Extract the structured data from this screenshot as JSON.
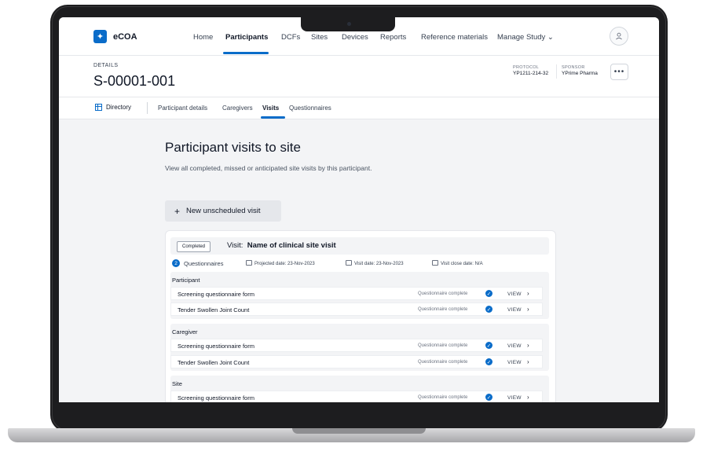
{
  "app": {
    "logo_text": "eCOA"
  },
  "nav": {
    "items": [
      "Home",
      "Participants",
      "DCFs",
      "Sites",
      "Devices",
      "Reports",
      "Reference materials",
      "Manage Study ⌄"
    ],
    "active": "Participants"
  },
  "details": {
    "kicker": "DETAILS",
    "id": "S-00001-001",
    "protocol_label": "PROTOCOL",
    "protocol_value": "YP1211-214-32",
    "sponsor_label": "SPONSOR",
    "sponsor_value": "YPrime Pharma",
    "more_label": "•••"
  },
  "subnav": {
    "directory_label": "Directory",
    "tabs": [
      "Participant details",
      "Caregivers",
      "Visits",
      "Questionnaires"
    ],
    "active": "Visits"
  },
  "page": {
    "title": "Participant visits to site",
    "description": "View all completed, missed or anticipated site visits by this participant.",
    "new_visit_label": "New unscheduled visit"
  },
  "visit": {
    "status": "Completed",
    "name_prefix": "Visit:",
    "name": "Name of clinical site visit",
    "questionnaire_count": "2",
    "questionnaires_label": "Questionnaires",
    "projected_date": "Projected date: 23-Nov-2023",
    "visit_date": "Visit date: 23-Nov-2023",
    "close_date": "Visit close date: N/A",
    "groups": [
      {
        "label": "Participant",
        "rows": [
          {
            "name": "Screening questionnaire form",
            "status": "Questionnaire complete",
            "action": "VIEW"
          },
          {
            "name": "Tender Swollen Joint Count",
            "status": "Questionnaire complete",
            "action": "VIEW"
          }
        ]
      },
      {
        "label": "Caregiver",
        "rows": [
          {
            "name": "Screening questionnaire form",
            "status": "Questionnaire complete",
            "action": "VIEW"
          },
          {
            "name": "Tender Swollen Joint Count",
            "status": "Questionnaire complete",
            "action": "VIEW"
          }
        ]
      },
      {
        "label": "Site",
        "rows": [
          {
            "name": "Screening questionnaire form",
            "status": "Questionnaire complete",
            "action": "VIEW"
          }
        ]
      }
    ]
  }
}
